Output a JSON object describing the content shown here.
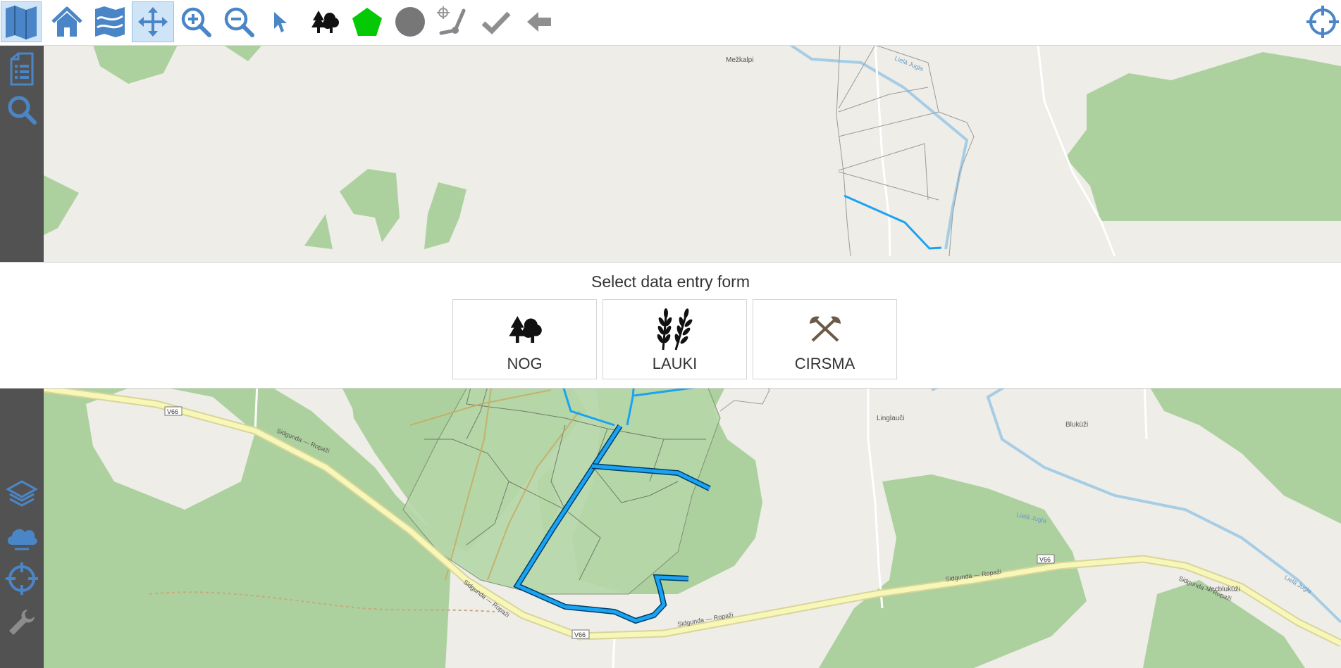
{
  "toolbar": {
    "buttons": [
      {
        "name": "map-view-icon",
        "active": false
      },
      {
        "name": "home-icon",
        "active": false
      },
      {
        "name": "layers-map-icon",
        "active": false
      },
      {
        "name": "pan-move-icon",
        "active": true
      },
      {
        "name": "zoom-in-icon",
        "active": false
      },
      {
        "name": "zoom-out-icon",
        "active": false
      },
      {
        "name": "select-pointer-icon",
        "active": false
      },
      {
        "name": "forest-trees-icon",
        "active": false
      },
      {
        "name": "draw-polygon-icon",
        "active": false
      },
      {
        "name": "draw-circle-icon",
        "active": false
      },
      {
        "name": "draw-line-icon",
        "active": false
      },
      {
        "name": "finish-checkmark-icon",
        "active": false
      },
      {
        "name": "back-arrow-icon",
        "active": false
      },
      {
        "name": "locate-crosshair-icon",
        "active": false
      }
    ]
  },
  "siderail": {
    "items": [
      "document-list-icon",
      "search-icon",
      "layers-icon",
      "cloud-icon",
      "location-crosshair-icon",
      "wrench-icon"
    ]
  },
  "dialog": {
    "title": "Select data entry form",
    "forms": [
      {
        "label": "NOG",
        "icon": "trees-icon"
      },
      {
        "label": "LAUKI",
        "icon": "wheat-icon"
      },
      {
        "label": "CIRSMA",
        "icon": "crossed-axes-icon"
      }
    ]
  },
  "map": {
    "labels": {
      "mezkalpi": "Mežkalpi",
      "linglauci": "Linglauči",
      "blukuzi": "Blukūži",
      "vecblukuzi": "Vecblukūži",
      "road_v66_1": "V66",
      "road_v66_2": "V66",
      "road_v66_3": "V66",
      "road_name_1": "Sidgunda — Ropaži",
      "road_name_2": "Sidgunda — Ropaži",
      "road_name_3": "Sidgunda — Ropaži",
      "road_name_4": "Sidgunda — Ropaži",
      "road_name_5": "Sidgunda — Ropaži",
      "river_1": "Lielā Jugla",
      "river_2": "Lielā Jugla",
      "river_3": "Lielā Jugla"
    },
    "colors": {
      "background": "#eeede8",
      "forest": "#add19e",
      "ditch": "#1aa3f2",
      "road": "#f7f7b8",
      "river": "#a6cde6",
      "selection": "#b6d7a8"
    }
  }
}
